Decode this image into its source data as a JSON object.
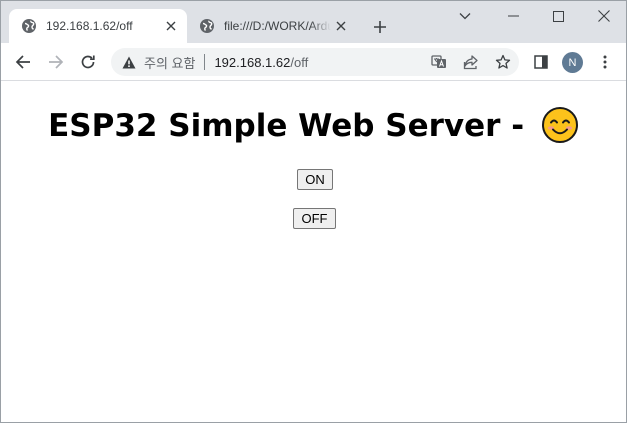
{
  "browser": {
    "tabs": [
      {
        "title": "192.168.1.62/off",
        "active": true,
        "icon": "globe-icon"
      },
      {
        "title": "file:///D:/WORK/Arduino",
        "active": false,
        "icon": "globe-icon"
      }
    ],
    "address_bar": {
      "security_label": "주의 요함",
      "url_host": "192.168.1.62",
      "url_path": "/off"
    },
    "profile_initial": "N"
  },
  "page": {
    "title": "ESP32 Simple Web Server - ",
    "title_emoji": "smiling-face-icon",
    "buttons": {
      "on_label": "ON",
      "off_label": "OFF"
    }
  },
  "colors": {
    "tabstrip_bg": "#dee1e6",
    "omnibox_bg": "#f1f3f4",
    "avatar_bg": "#5f7a94",
    "button_bg": "#efefef"
  }
}
